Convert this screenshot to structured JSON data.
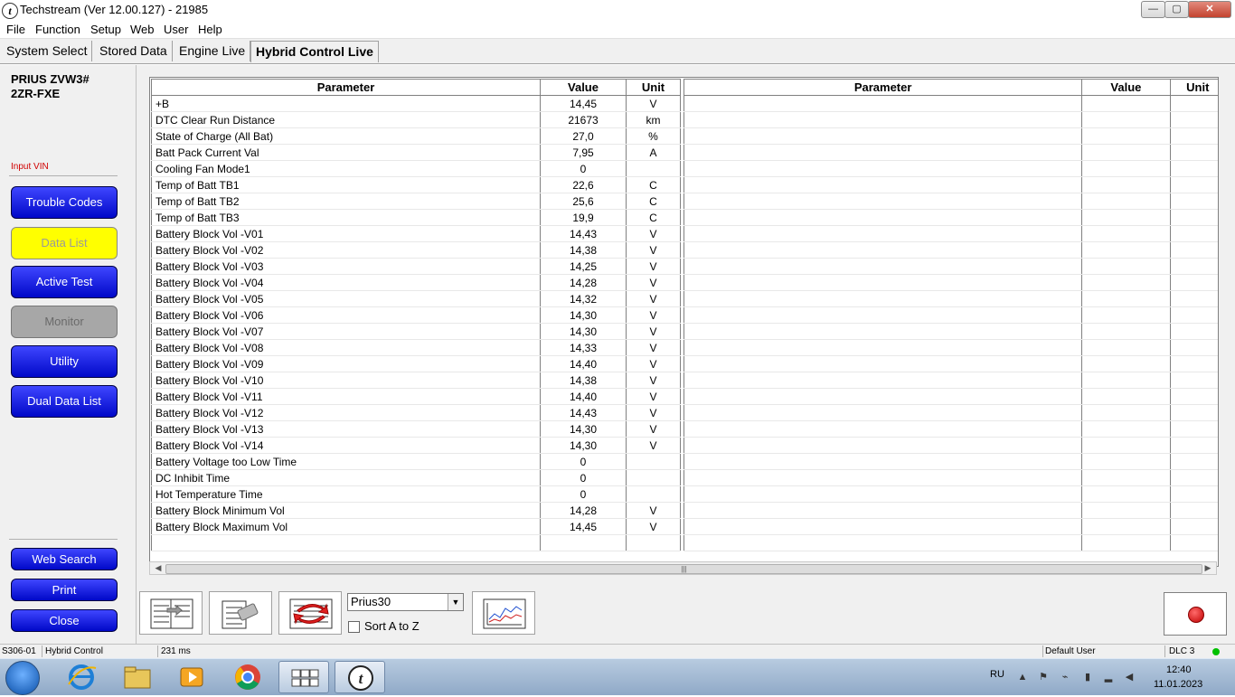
{
  "window": {
    "title": "Techstream (Ver 12.00.127) - 21985",
    "app_icon": "t",
    "controls": {
      "minimize": "—",
      "maximize": "▢",
      "close": "✕"
    }
  },
  "menu": [
    "File",
    "Function",
    "Setup",
    "Web",
    "User",
    "Help"
  ],
  "tabs": [
    "System Select",
    "Stored Data",
    "Engine Live",
    "Hybrid Control Live"
  ],
  "active_tab": "Hybrid Control Live",
  "sidebar": {
    "vehicle_line1": "PRIUS ZVW3#",
    "vehicle_line2": "2ZR-FXE",
    "input_vin": "Input VIN",
    "buttons": [
      "Trouble Codes",
      "Data List",
      "Active Test",
      "Monitor",
      "Utility",
      "Dual Data List"
    ],
    "active_button": "Data List",
    "disabled_button": "Monitor",
    "bottom_buttons": [
      "Web Search",
      "Print",
      "Close"
    ]
  },
  "table": {
    "headers": [
      "Parameter",
      "Value",
      "Unit"
    ],
    "rows": [
      [
        "+B",
        "14,45",
        "V"
      ],
      [
        "DTC Clear Run Distance",
        "21673",
        "km"
      ],
      [
        "State of Charge (All Bat)",
        "27,0",
        "%"
      ],
      [
        "Batt Pack Current Val",
        "7,95",
        "A"
      ],
      [
        "Cooling Fan Mode1",
        "0",
        ""
      ],
      [
        "Temp of Batt TB1",
        "22,6",
        "C"
      ],
      [
        "Temp of Batt TB2",
        "25,6",
        "C"
      ],
      [
        "Temp of Batt TB3",
        "19,9",
        "C"
      ],
      [
        "Battery Block Vol -V01",
        "14,43",
        "V"
      ],
      [
        "Battery Block Vol -V02",
        "14,38",
        "V"
      ],
      [
        "Battery Block Vol -V03",
        "14,25",
        "V"
      ],
      [
        "Battery Block Vol -V04",
        "14,28",
        "V"
      ],
      [
        "Battery Block Vol -V05",
        "14,32",
        "V"
      ],
      [
        "Battery Block Vol -V06",
        "14,30",
        "V"
      ],
      [
        "Battery Block Vol -V07",
        "14,30",
        "V"
      ],
      [
        "Battery Block Vol -V08",
        "14,33",
        "V"
      ],
      [
        "Battery Block Vol -V09",
        "14,40",
        "V"
      ],
      [
        "Battery Block Vol -V10",
        "14,38",
        "V"
      ],
      [
        "Battery Block Vol -V11",
        "14,40",
        "V"
      ],
      [
        "Battery Block Vol -V12",
        "14,43",
        "V"
      ],
      [
        "Battery Block Vol -V13",
        "14,30",
        "V"
      ],
      [
        "Battery Block Vol -V14",
        "14,30",
        "V"
      ],
      [
        "Battery Voltage too Low Time",
        "0",
        ""
      ],
      [
        "DC Inhibit Time",
        "0",
        ""
      ],
      [
        "Hot Temperature Time",
        "0",
        ""
      ],
      [
        "Battery Block Minimum Vol",
        "14,28",
        "V"
      ],
      [
        "Battery Block Maximum Vol",
        "14,45",
        "V"
      ]
    ]
  },
  "scrollbar_thumb_grip": "|||",
  "toolbar": {
    "combo_value": "Prius30",
    "combo_arrow": "▼",
    "sort_label": "Sort A to Z",
    "sort_checked": false
  },
  "status": {
    "code": "S306-01",
    "system": "Hybrid Control",
    "timing": "231 ms",
    "user": "Default User",
    "dlc": "DLC 3",
    "dlc_color": "#00c000"
  },
  "taskbar": {
    "language": "RU",
    "time": "12:40",
    "date": "11.01.2023",
    "apps": [
      "internet-explorer",
      "file-explorer",
      "media-player",
      "chrome",
      "app-grid",
      "techstream"
    ]
  }
}
